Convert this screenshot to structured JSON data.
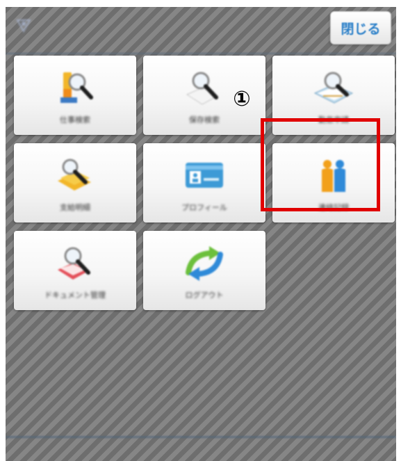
{
  "header": {
    "title": "",
    "close_label": "閉じる"
  },
  "annotation": {
    "step_marker": "①"
  },
  "menu": {
    "tiles": [
      {
        "label": "仕事検索",
        "icon": "search-document-icon"
      },
      {
        "label": "保存検索",
        "icon": "search-paper-icon"
      },
      {
        "label": "勤怠申請",
        "icon": "search-book-icon"
      },
      {
        "label": "支給明細",
        "icon": "search-money-icon"
      },
      {
        "label": "プロフィール",
        "icon": "profile-card-icon"
      },
      {
        "label": "連絡記録",
        "icon": "people-icon"
      },
      {
        "label": "ドキュメント管理",
        "icon": "search-document-red-icon"
      },
      {
        "label": "ログアウト",
        "icon": "logout-arrows-icon"
      }
    ]
  },
  "colors": {
    "accent": "#2a7fc8",
    "highlight": "#e00000",
    "background_stripe_dark": "#6e6e6e",
    "background_stripe_light": "#868686"
  }
}
